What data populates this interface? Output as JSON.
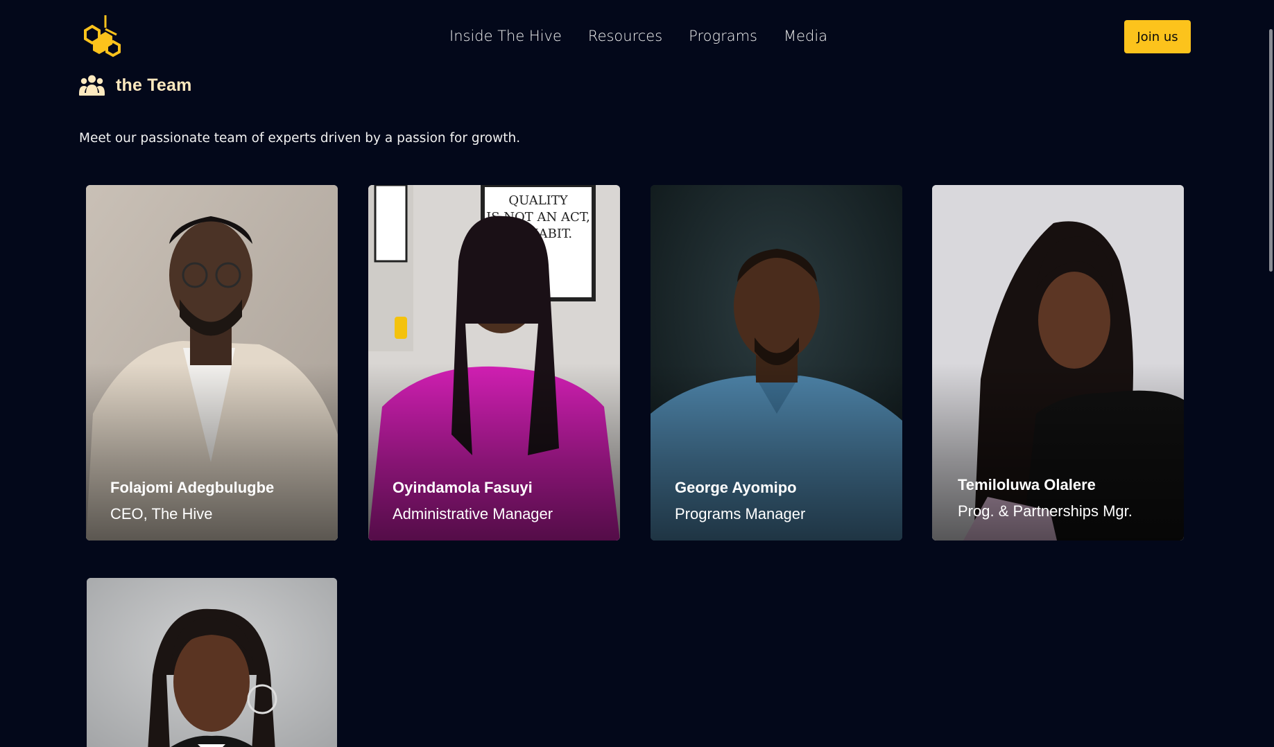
{
  "header": {
    "logo_name": "hive-logo",
    "nav": [
      {
        "label": "Inside The Hive"
      },
      {
        "label": "Resources"
      },
      {
        "label": "Programs"
      },
      {
        "label": "Media"
      }
    ],
    "cta_label": "Join us"
  },
  "section": {
    "icon": "team-icon",
    "title": "the Team",
    "intro": "Meet our passionate team of experts driven by a passion for growth."
  },
  "team": [
    {
      "name": "Folajomi Adegbulugbe",
      "role": "CEO, The Hive"
    },
    {
      "name": "Oyindamola Fasuyi",
      "role": "Administrative Manager"
    },
    {
      "name": "George Ayomipo",
      "role": "Programs Manager"
    },
    {
      "name": "Temiloluwa Olalere",
      "role": "Prog. & Partnerships Mgr."
    }
  ],
  "photo_text": {
    "poster_line1": "QUALITY",
    "poster_line2": "IS NOT AN ACT,",
    "poster_line3": "HABIT."
  },
  "colors": {
    "background": "#03081a",
    "accent": "#fcc31c",
    "heading": "#fde9bf"
  }
}
